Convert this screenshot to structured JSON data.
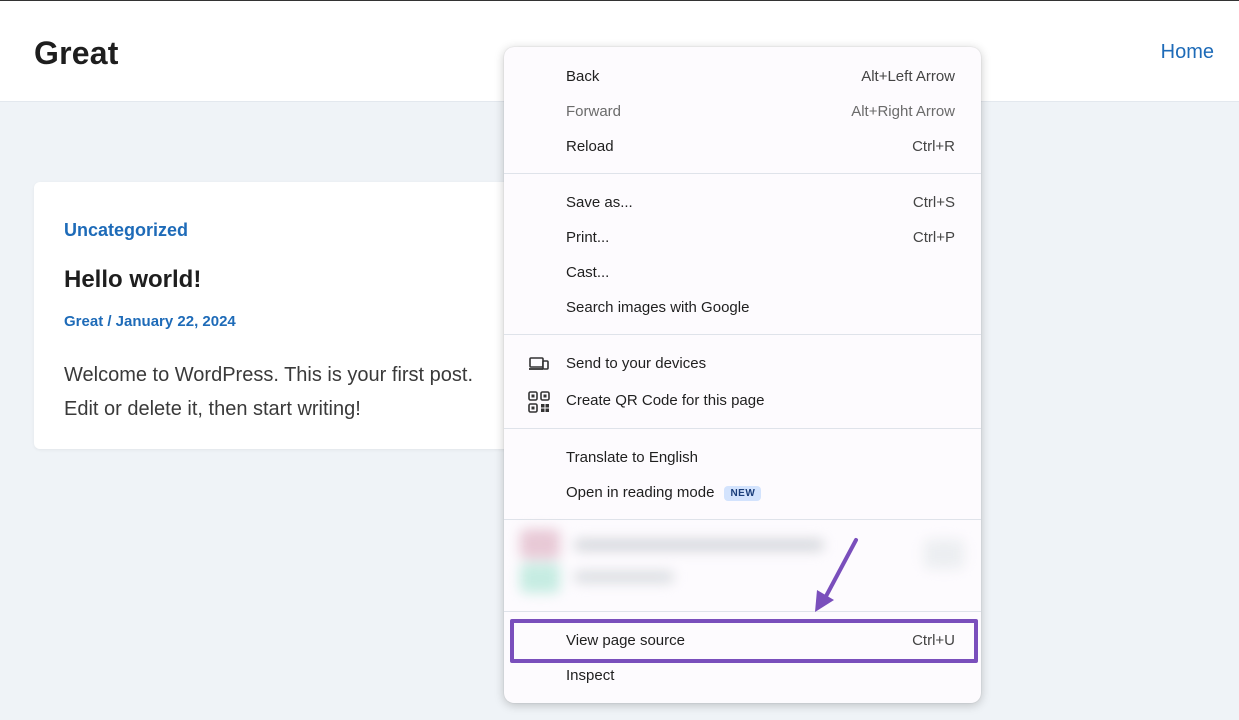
{
  "site": {
    "title": "Great",
    "nav_home": "Home"
  },
  "post": {
    "category": "Uncategorized",
    "title": "Hello world!",
    "meta": "Great / January 22, 2024",
    "excerpt_line1": "Welcome to WordPress. This is your first post.",
    "excerpt_line2": "Edit or delete it, then start writing!"
  },
  "context_menu": {
    "back": {
      "label": "Back",
      "shortcut": "Alt+Left Arrow"
    },
    "forward": {
      "label": "Forward",
      "shortcut": "Alt+Right Arrow"
    },
    "reload": {
      "label": "Reload",
      "shortcut": "Ctrl+R"
    },
    "save_as": {
      "label": "Save as...",
      "shortcut": "Ctrl+S"
    },
    "print": {
      "label": "Print...",
      "shortcut": "Ctrl+P"
    },
    "cast": {
      "label": "Cast..."
    },
    "search_images": {
      "label": "Search images with Google"
    },
    "send_devices": {
      "label": "Send to your devices",
      "icon": "devices-icon"
    },
    "qr_code": {
      "label": "Create QR Code for this page",
      "icon": "qr-code-icon"
    },
    "translate": {
      "label": "Translate to English"
    },
    "reading_mode": {
      "label": "Open in reading mode",
      "badge": "NEW"
    },
    "view_source": {
      "label": "View page source",
      "shortcut": "Ctrl+U"
    },
    "inspect": {
      "label": "Inspect"
    }
  },
  "colors": {
    "accent": "#1e6bb8",
    "annotation": "#7a4fbc",
    "background": "#eff3f7"
  }
}
